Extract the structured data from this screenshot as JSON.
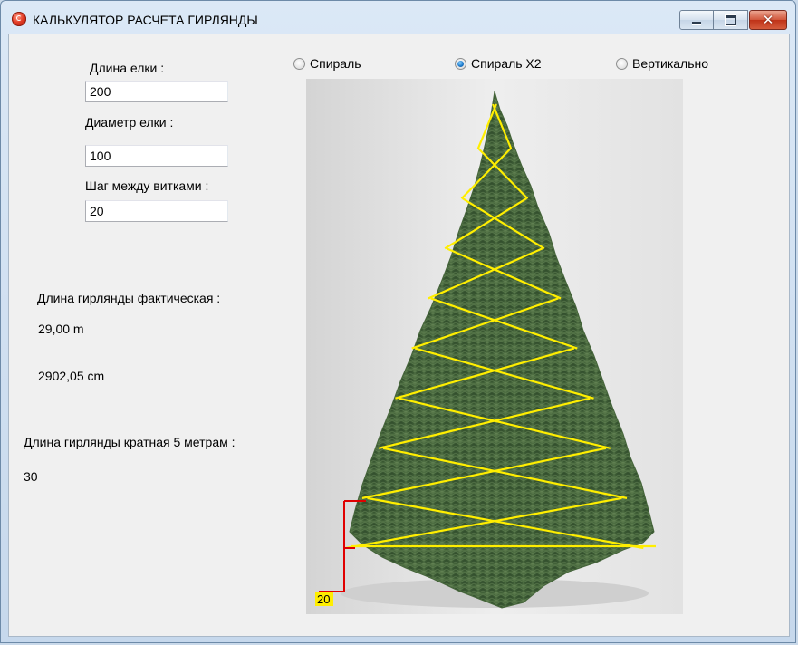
{
  "window": {
    "title": "КАЛЬКУЛЯТОР РАСЧЕТА  ГИРЛЯНДЫ",
    "close_glyph": "✕"
  },
  "form": {
    "tree_height_label": "Длина елки :",
    "tree_height_value": "200",
    "tree_diameter_label": "Диаметр елки :",
    "tree_diameter_value": "100",
    "step_label": "Шаг между витками :",
    "step_value": "20"
  },
  "results": {
    "actual_length_label": "Длина гирлянды фактическая :",
    "actual_length_m": "29,00 m",
    "actual_length_cm": "2902,05 cm",
    "multiple_label": "Длина гирлянды кратная  5 метрам :",
    "multiple_value": "30"
  },
  "mode": {
    "options": [
      {
        "label": "Спираль",
        "checked": false
      },
      {
        "label": "Спираль X2",
        "checked": true
      },
      {
        "label": "Вертикально",
        "checked": false
      }
    ]
  },
  "preview": {
    "step_marker_label": "20",
    "garland_color": "#ffee00",
    "marker_color": "#e00000",
    "tree_color": "#3f5c36",
    "background_color": "#e7e7e7"
  }
}
